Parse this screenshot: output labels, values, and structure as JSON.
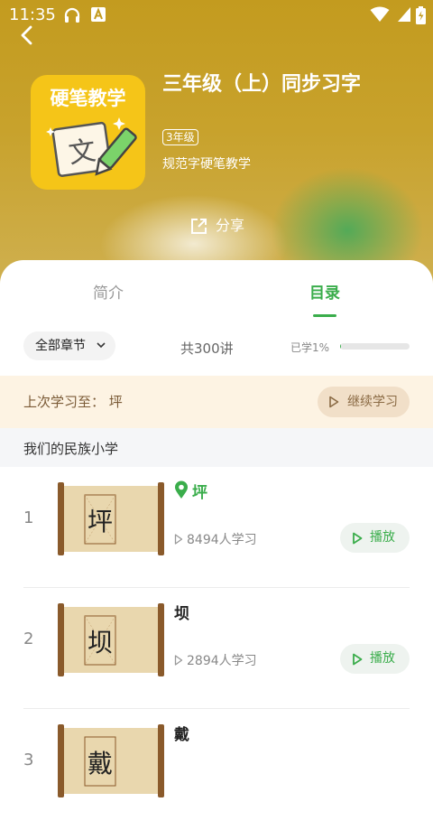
{
  "status_bar": {
    "time": "11:35"
  },
  "course": {
    "cover_title": "硬笔教学",
    "cover_char": "文",
    "title": "三年级（上）同步习字",
    "grade_badge": "3年级",
    "subtitle": "规范字硬笔教学",
    "share_label": "分享"
  },
  "tabs": [
    {
      "label": "简介",
      "active": false
    },
    {
      "label": "目录",
      "active": true
    }
  ],
  "filter": {
    "chapter_label": "全部章节",
    "total": "共300讲",
    "learned_label": "已学1%",
    "progress_fraction": 0.01
  },
  "last_study": {
    "label": "上次学习至：  坪",
    "continue_label": "继续学习"
  },
  "section": {
    "title": "我们的民族小学"
  },
  "lessons": [
    {
      "index": "1",
      "name": "坪",
      "students": "8494人学习",
      "play_label": "播放",
      "current": true
    },
    {
      "index": "2",
      "name": "坝",
      "students": "2894人学习",
      "play_label": "播放",
      "current": false
    },
    {
      "index": "3",
      "name": "戴",
      "students": "",
      "play_label": "",
      "current": false
    }
  ],
  "colors": {
    "accent_green": "#3aad4b",
    "hero_yellow": "#c39b1f",
    "cover_yellow": "#f5c518",
    "continue_bg": "#fdf3e3"
  },
  "icons": [
    "back-icon",
    "location-pin-icon",
    "play-icon",
    "share-icon",
    "chevron-down-icon",
    "wifi-icon",
    "battery-icon"
  ]
}
